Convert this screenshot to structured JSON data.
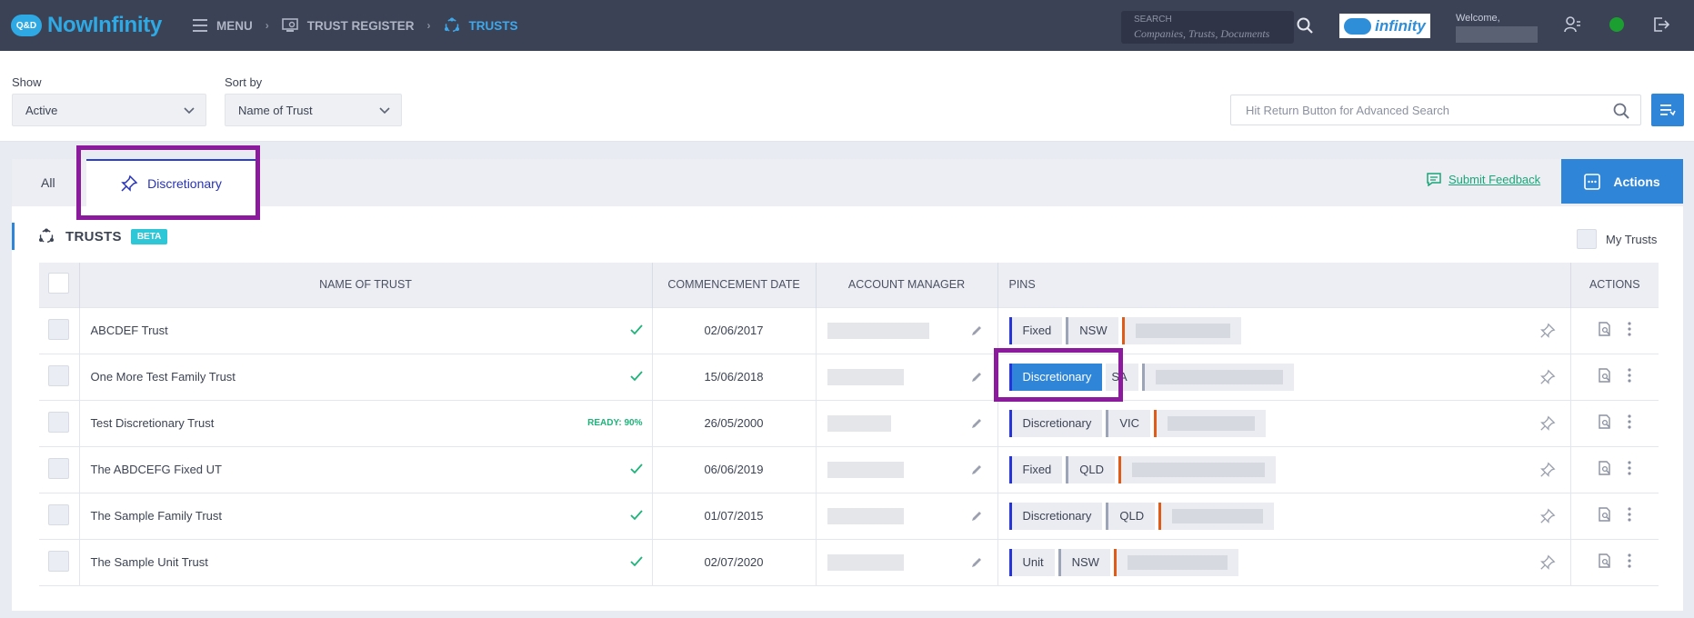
{
  "header": {
    "logo_badge": "Q&D",
    "logo_text": "NowInfinity",
    "nav": {
      "menu": "MENU",
      "register": "TRUST REGISTER",
      "current": "TRUSTS"
    },
    "search_label": "SEARCH",
    "search_placeholder": "Companies, Trusts, Documents",
    "partner_logo_text": "infinity",
    "welcome": "Welcome,"
  },
  "filters": {
    "show_label": "Show",
    "show_value": "Active",
    "sort_label": "Sort by",
    "sort_value": "Name of Trust",
    "advanced_search_placeholder": "Hit Return Button for Advanced Search"
  },
  "tabs": {
    "all": "All",
    "discretionary": "Discretionary"
  },
  "feedback_link": "Submit Feedback",
  "actions_button": "Actions",
  "section": {
    "title": "TRUSTS",
    "badge": "BETA",
    "my_trusts": "My Trusts"
  },
  "table": {
    "headers": {
      "name": "NAME OF TRUST",
      "date": "COMMENCEMENT DATE",
      "manager": "ACCOUNT MANAGER",
      "pins": "PINS",
      "actions": "ACTIONS"
    },
    "rows": [
      {
        "name": "ABCDEF Trust",
        "status": "",
        "date": "02/06/2017",
        "pin1": "Fixed",
        "pin2": "NSW"
      },
      {
        "name": "One More Test Family Trust",
        "status": "",
        "date": "15/06/2018",
        "pin1": "Discretionary",
        "pin2": "SA"
      },
      {
        "name": "Test Discretionary Trust",
        "status": "READY: 90%",
        "date": "26/05/2000",
        "pin1": "Discretionary",
        "pin2": "VIC"
      },
      {
        "name": "The ABDCEFG Fixed UT",
        "status": "",
        "date": "06/06/2019",
        "pin1": "Fixed",
        "pin2": "QLD"
      },
      {
        "name": "The Sample Family Trust",
        "status": "",
        "date": "01/07/2015",
        "pin1": "Discretionary",
        "pin2": "QLD"
      },
      {
        "name": "The Sample Unit Trust",
        "status": "",
        "date": "02/07/2020",
        "pin1": "Unit",
        "pin2": "NSW"
      }
    ]
  },
  "colors": {
    "topbar": "#3b4255",
    "accent_blue": "#2f86d8",
    "highlight_purple": "#8b1b9c",
    "success_green": "#1aa578"
  }
}
